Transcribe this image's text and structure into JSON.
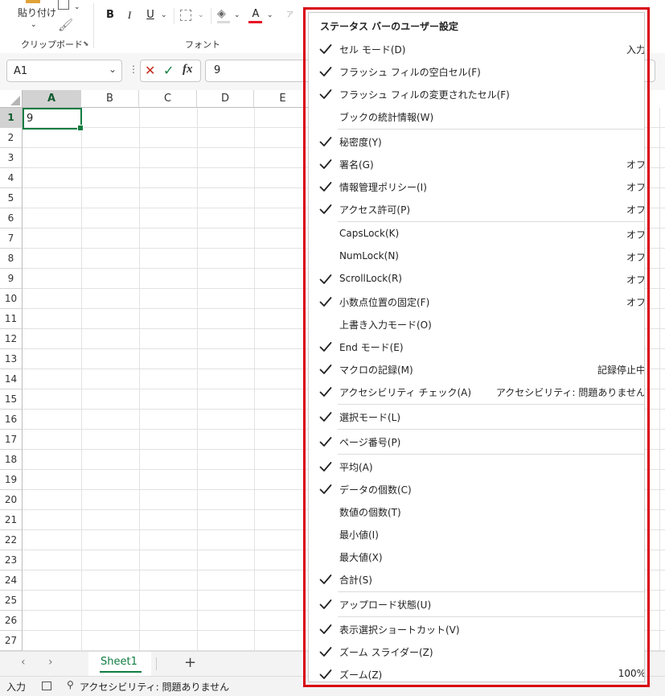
{
  "ribbon": {
    "paste_label": "貼り付け",
    "clipboard_group": "クリップボード",
    "font_group": "フォント",
    "bold": "B",
    "italic": "I",
    "underline": "U",
    "font_color_letter": "A"
  },
  "formula_bar": {
    "name_box": "A1",
    "formula_value": "9",
    "fx": "fx"
  },
  "grid": {
    "columns": [
      "A",
      "B",
      "C",
      "D",
      "E"
    ],
    "rows": [
      "1",
      "2",
      "3",
      "4",
      "5",
      "6",
      "7",
      "8",
      "9",
      "10",
      "11",
      "12",
      "13",
      "14",
      "15",
      "16",
      "17",
      "18",
      "19",
      "20",
      "21",
      "22",
      "23",
      "24",
      "25",
      "26",
      "27"
    ],
    "a1_value": "9"
  },
  "sheet_tabs": {
    "tabs": [
      "Sheet1"
    ],
    "add_symbol": "+"
  },
  "status_bar": {
    "mode": "入力",
    "accessibility": "アクセシビリティ: 問題ありません"
  },
  "menu": {
    "title": "ステータス バーのユーザー設定",
    "items": [
      {
        "label": "セル モード(D)",
        "value": "入力",
        "checked": true
      },
      {
        "label": "フラッシュ フィルの空白セル(F)",
        "value": "",
        "checked": true
      },
      {
        "label": "フラッシュ フィルの変更されたセル(F)",
        "value": "",
        "checked": true
      },
      {
        "label": "ブックの統計情報(W)",
        "value": "",
        "checked": false
      },
      {
        "label": "秘密度(Y)",
        "value": "",
        "checked": true
      },
      {
        "label": "署名(G)",
        "value": "オフ",
        "checked": true
      },
      {
        "label": "情報管理ポリシー(I)",
        "value": "オフ",
        "checked": true
      },
      {
        "label": "アクセス許可(P)",
        "value": "オフ",
        "checked": true
      },
      {
        "label": "CapsLock(K)",
        "value": "オフ",
        "checked": false
      },
      {
        "label": "NumLock(N)",
        "value": "オフ",
        "checked": false
      },
      {
        "label": "ScrollLock(R)",
        "value": "オフ",
        "checked": true
      },
      {
        "label": "小数点位置の固定(F)",
        "value": "オフ",
        "checked": true
      },
      {
        "label": "上書き入力モード(O)",
        "value": "",
        "checked": false
      },
      {
        "label": "End モード(E)",
        "value": "",
        "checked": true
      },
      {
        "label": "マクロの記録(M)",
        "value": "記録停止中",
        "checked": true
      },
      {
        "label": "アクセシビリティ チェック(A)",
        "value": "アクセシビリティ: 問題ありません",
        "checked": true
      },
      {
        "label": "選択モード(L)",
        "value": "",
        "checked": true
      },
      {
        "label": "ページ番号(P)",
        "value": "",
        "checked": true
      },
      {
        "label": "平均(A)",
        "value": "",
        "checked": true
      },
      {
        "label": "データの個数(C)",
        "value": "",
        "checked": true
      },
      {
        "label": "数値の個数(T)",
        "value": "",
        "checked": false
      },
      {
        "label": "最小値(I)",
        "value": "",
        "checked": false
      },
      {
        "label": "最大値(X)",
        "value": "",
        "checked": false
      },
      {
        "label": "合計(S)",
        "value": "",
        "checked": true
      },
      {
        "label": "アップロード状態(U)",
        "value": "",
        "checked": true
      },
      {
        "label": "表示選択ショートカット(V)",
        "value": "",
        "checked": true
      },
      {
        "label": "ズーム スライダー(Z)",
        "value": "",
        "checked": true
      },
      {
        "label": "ズーム(Z)",
        "value": "100%",
        "checked": true
      }
    ]
  },
  "colors": {
    "highlight_border": "#d9000f",
    "excel_green": "#107c41"
  }
}
